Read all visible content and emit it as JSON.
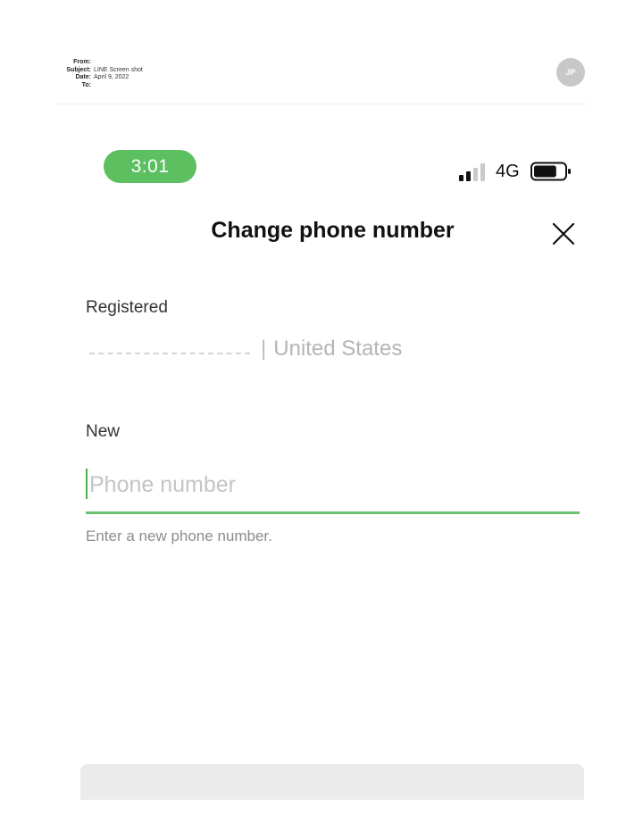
{
  "email": {
    "from_label": "From:",
    "subject_label": "Subject:",
    "subject_value": "LINE Screen shot",
    "date_label": "Date:",
    "date_value": "April 9, 2022",
    "to_label": "To:",
    "avatar_initials": "JP"
  },
  "status_bar": {
    "time": "3:01",
    "network": "4G",
    "signal_bars_active": 2,
    "signal_bars_total": 4,
    "battery_level": 0.75,
    "time_pill_color": "#5cbf60"
  },
  "screen": {
    "title": "Change phone number",
    "close_icon": "close-icon"
  },
  "registered": {
    "label": "Registered",
    "separator": "|",
    "country": "United States"
  },
  "new_number": {
    "label": "New",
    "placeholder": "Phone number",
    "value": "",
    "helper": "Enter a new phone number.",
    "accent_color": "#6cc070"
  }
}
